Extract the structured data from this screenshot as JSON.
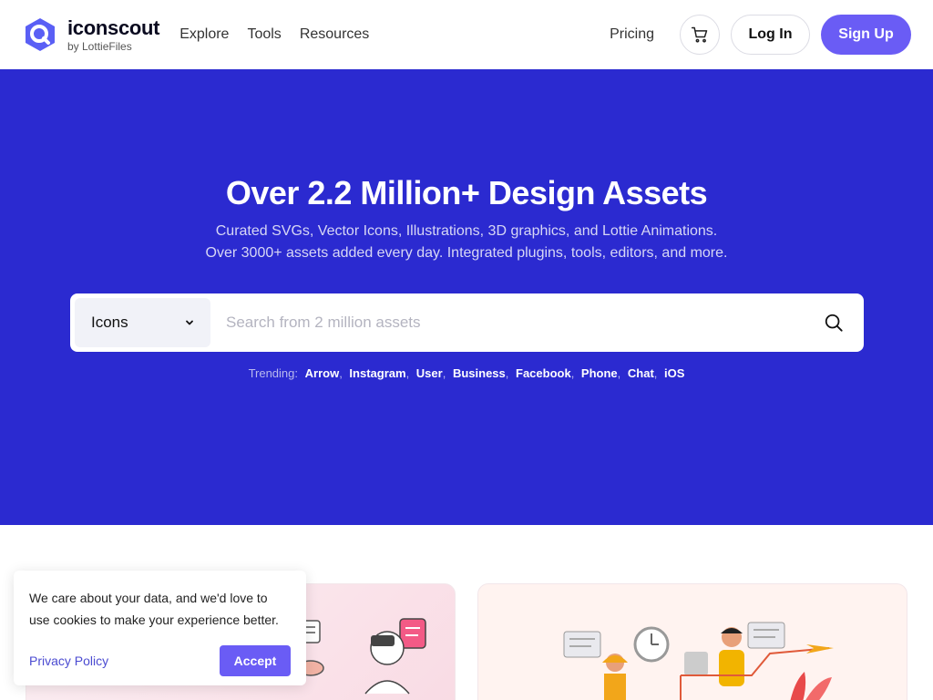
{
  "brand": {
    "name": "iconscout",
    "byline": "by LottieFiles",
    "color": "#5a5ff5"
  },
  "nav": {
    "items": [
      "Explore",
      "Tools",
      "Resources"
    ]
  },
  "header": {
    "pricing": "Pricing",
    "cart_icon": "cart-icon",
    "login": "Log In",
    "signup": "Sign Up"
  },
  "hero": {
    "title": "Over 2.2 Million+ Design Assets",
    "subtitle_line1": "Curated SVGs, Vector Icons, Illustrations, 3D graphics, and Lottie Animations.",
    "subtitle_line2": "Over 3000+ assets added every day. Integrated plugins, tools, editors, and more.",
    "background": "#2b2ad0"
  },
  "search": {
    "type_selected": "Icons",
    "placeholder": "Search from 2 million assets",
    "value": ""
  },
  "trending": {
    "label": "Trending:",
    "tags": [
      "Arrow",
      "Instagram",
      "User",
      "Business",
      "Facebook",
      "Phone",
      "Chat",
      "iOS"
    ]
  },
  "cookie": {
    "text": "We care about your data, and we'd love to use cookies to make your experience better.",
    "privacy_link": "Privacy Policy",
    "accept": "Accept"
  },
  "accent": "#6a5cf5"
}
